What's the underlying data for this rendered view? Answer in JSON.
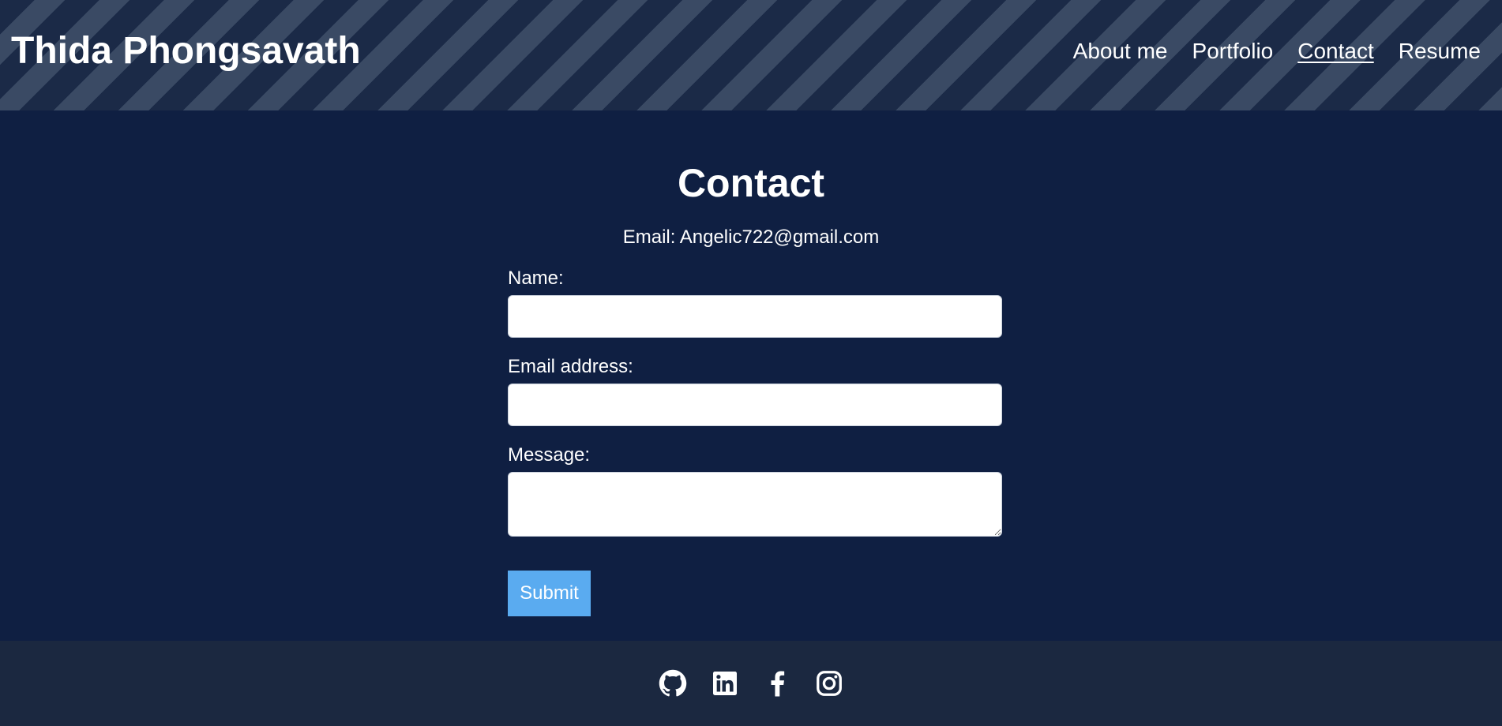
{
  "header": {
    "brand": "Thida Phongsavath",
    "nav": [
      {
        "label": "About me"
      },
      {
        "label": "Portfolio"
      },
      {
        "label": "Contact",
        "active": true
      },
      {
        "label": "Resume"
      }
    ]
  },
  "main": {
    "title": "Contact",
    "email_line": "Email: Angelic722@gmail.com",
    "form": {
      "name_label": "Name:",
      "name_value": "",
      "email_label": "Email address:",
      "email_value": "",
      "message_label": "Message:",
      "message_value": "",
      "submit_label": "Submit"
    }
  },
  "footer": {
    "socials": [
      {
        "icon": "github-icon"
      },
      {
        "icon": "linkedin-icon"
      },
      {
        "icon": "facebook-icon"
      },
      {
        "icon": "instagram-icon"
      }
    ]
  },
  "colors": {
    "background": "#0f1f42",
    "header_stripe_dark": "#1b2a47",
    "header_stripe_light": "#3a4a64",
    "footer": "#1b2840",
    "submit_button": "#5aabf0",
    "text": "#ffffff"
  }
}
